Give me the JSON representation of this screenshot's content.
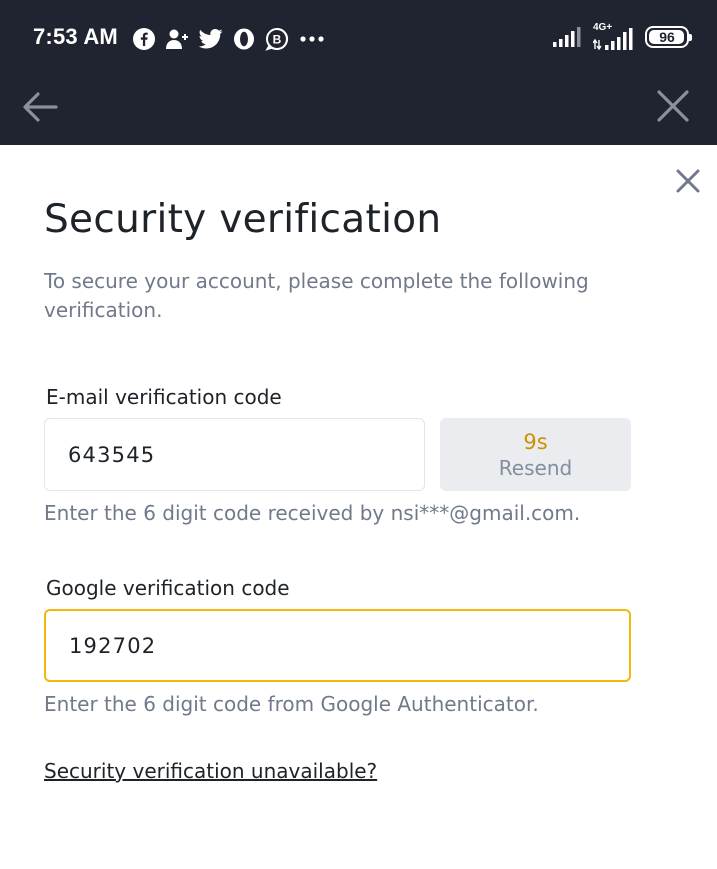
{
  "status_bar": {
    "time": "7:53 AM",
    "notification_icons": [
      "facebook-icon",
      "person-add-icon",
      "twitter-icon",
      "opera-icon",
      "business-icon",
      "more-icon"
    ],
    "network_label": "4G+",
    "battery_level": "96",
    "battery_fraction": 0.96
  },
  "app_bar": {
    "back_icon": "arrow-left-icon",
    "close_icon": "close-icon"
  },
  "dialog": {
    "close_icon": "close-icon",
    "title": "Security verification",
    "subtitle": "To secure your account, please complete the following verification.",
    "email": {
      "label": "E-mail verification code",
      "value": "643545",
      "countdown": "9s",
      "resend_label": "Resend",
      "hint": "Enter the 6 digit code received by nsi***@gmail.com."
    },
    "google": {
      "label": "Google verification code",
      "value": "192702",
      "hint": "Enter the 6 digit code from Google Authenticator."
    },
    "unavailable_link": "Security verification unavailable?"
  },
  "colors": {
    "header_bg": "#1f2430",
    "accent": "#f0b90b",
    "countdown": "#c99400",
    "text_primary": "#1e2329",
    "text_secondary": "#707a8a",
    "button_bg": "#eaecef"
  }
}
